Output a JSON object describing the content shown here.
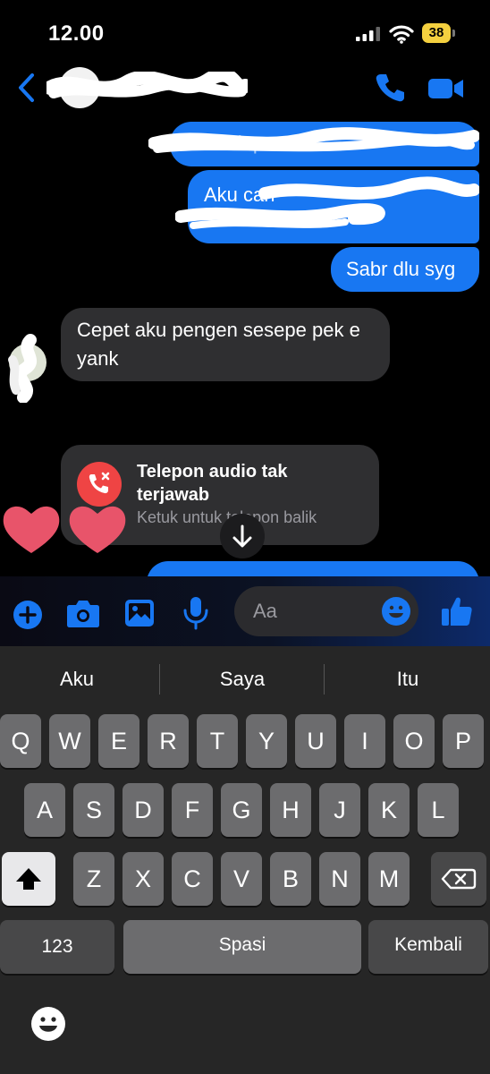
{
  "status_bar": {
    "time": "12.00",
    "battery": "38"
  },
  "header": {
    "back_icon": "chevron-left-icon",
    "call_icon": "phone-icon",
    "video_icon": "video-camera-icon"
  },
  "colors": {
    "accent": "#1877f2",
    "incoming_bubble": "#2f2f31",
    "missed_call": "#ef4444",
    "heart": "#e8546a",
    "battery": "#f4d03f"
  },
  "messages": [
    {
      "direction": "outgoing",
      "text": "Gak dapat"
    },
    {
      "direction": "outgoing",
      "text": "Aku cari"
    },
    {
      "direction": "outgoing",
      "text": "Sabr dlu syg"
    },
    {
      "direction": "incoming",
      "text": "Cepet aku pengen sesepe pek e yank"
    }
  ],
  "call_card": {
    "title": "Telepon audio tak terjawab",
    "subtitle": "Ketuk untuk telepon balik"
  },
  "composer": {
    "placeholder": "Aa"
  },
  "keyboard": {
    "suggestions": [
      "Aku",
      "Saya",
      "Itu"
    ],
    "row1": [
      "Q",
      "W",
      "E",
      "R",
      "T",
      "Y",
      "U",
      "I",
      "O",
      "P"
    ],
    "row2": [
      "A",
      "S",
      "D",
      "F",
      "G",
      "H",
      "J",
      "K",
      "L"
    ],
    "row3": [
      "Z",
      "X",
      "C",
      "V",
      "B",
      "N",
      "M"
    ],
    "numbers_key": "123",
    "space_key": "Spasi",
    "return_key": "Kembali"
  }
}
